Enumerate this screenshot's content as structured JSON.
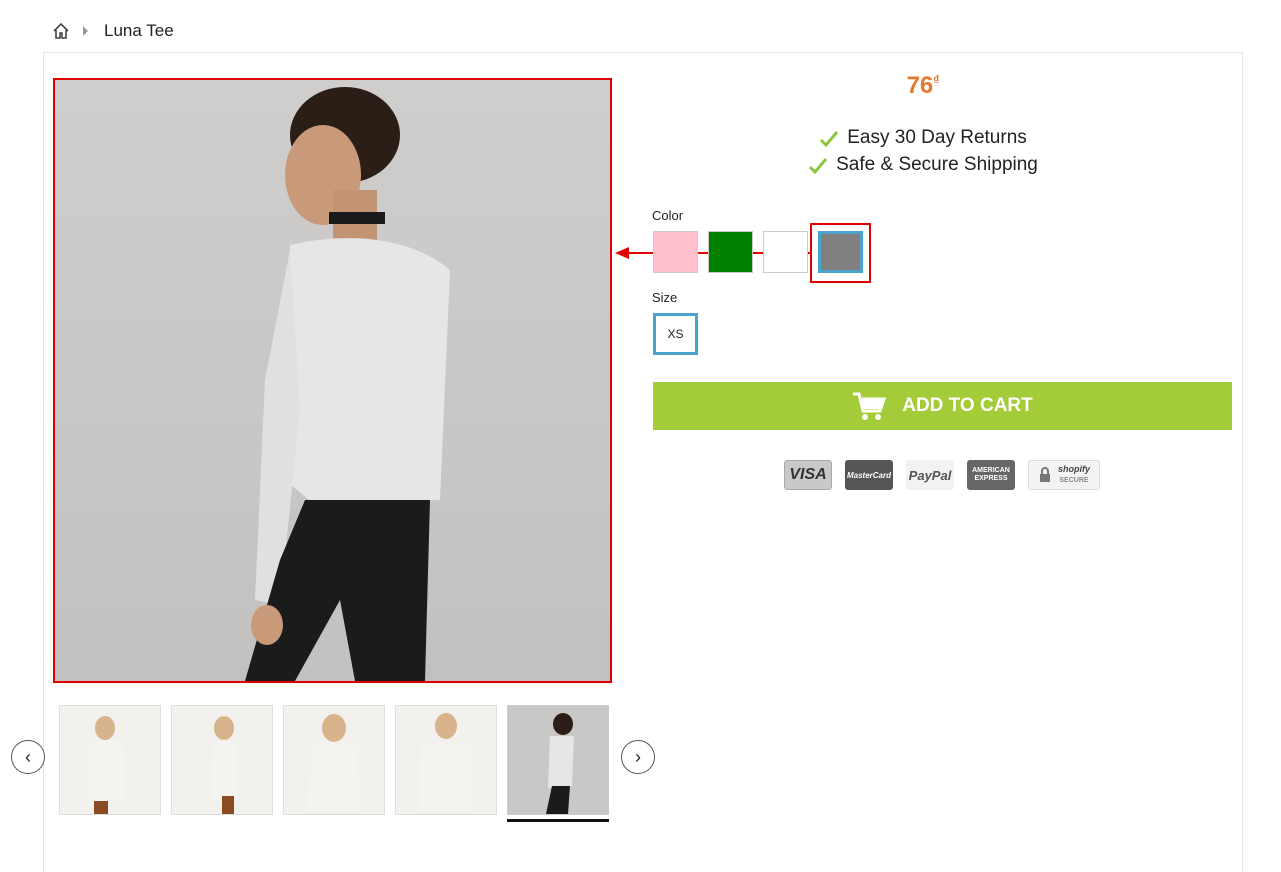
{
  "breadcrumb": {
    "home_icon": "home-icon",
    "current": "Luna Tee"
  },
  "product": {
    "price": "76",
    "currency": "₫",
    "price_color": "#e8772e",
    "perks": [
      "Easy 30 Day Returns",
      "Safe & Secure Shipping"
    ]
  },
  "options": {
    "color_label": "Color",
    "colors": [
      {
        "name": "pink",
        "hex": "#ffc0cb"
      },
      {
        "name": "green",
        "hex": "#008000"
      },
      {
        "name": "white",
        "hex": "#ffffff"
      },
      {
        "name": "gray",
        "hex": "#808080",
        "selected": true
      }
    ],
    "size_label": "Size",
    "sizes": [
      "XS"
    ]
  },
  "cart": {
    "label": "ADD TO CART",
    "color": "#a4cc38"
  },
  "payments": {
    "visa": "VISA",
    "mastercard": "MasterCard",
    "paypal": "PayPal",
    "amex_line1": "AMERICAN",
    "amex_line2": "EXPRESS",
    "shopify_line1": "shopify",
    "shopify_line2": "SECURE"
  },
  "gallery": {
    "thumb_count": 5,
    "active_index": 4
  },
  "annotation_color": "#e00000"
}
